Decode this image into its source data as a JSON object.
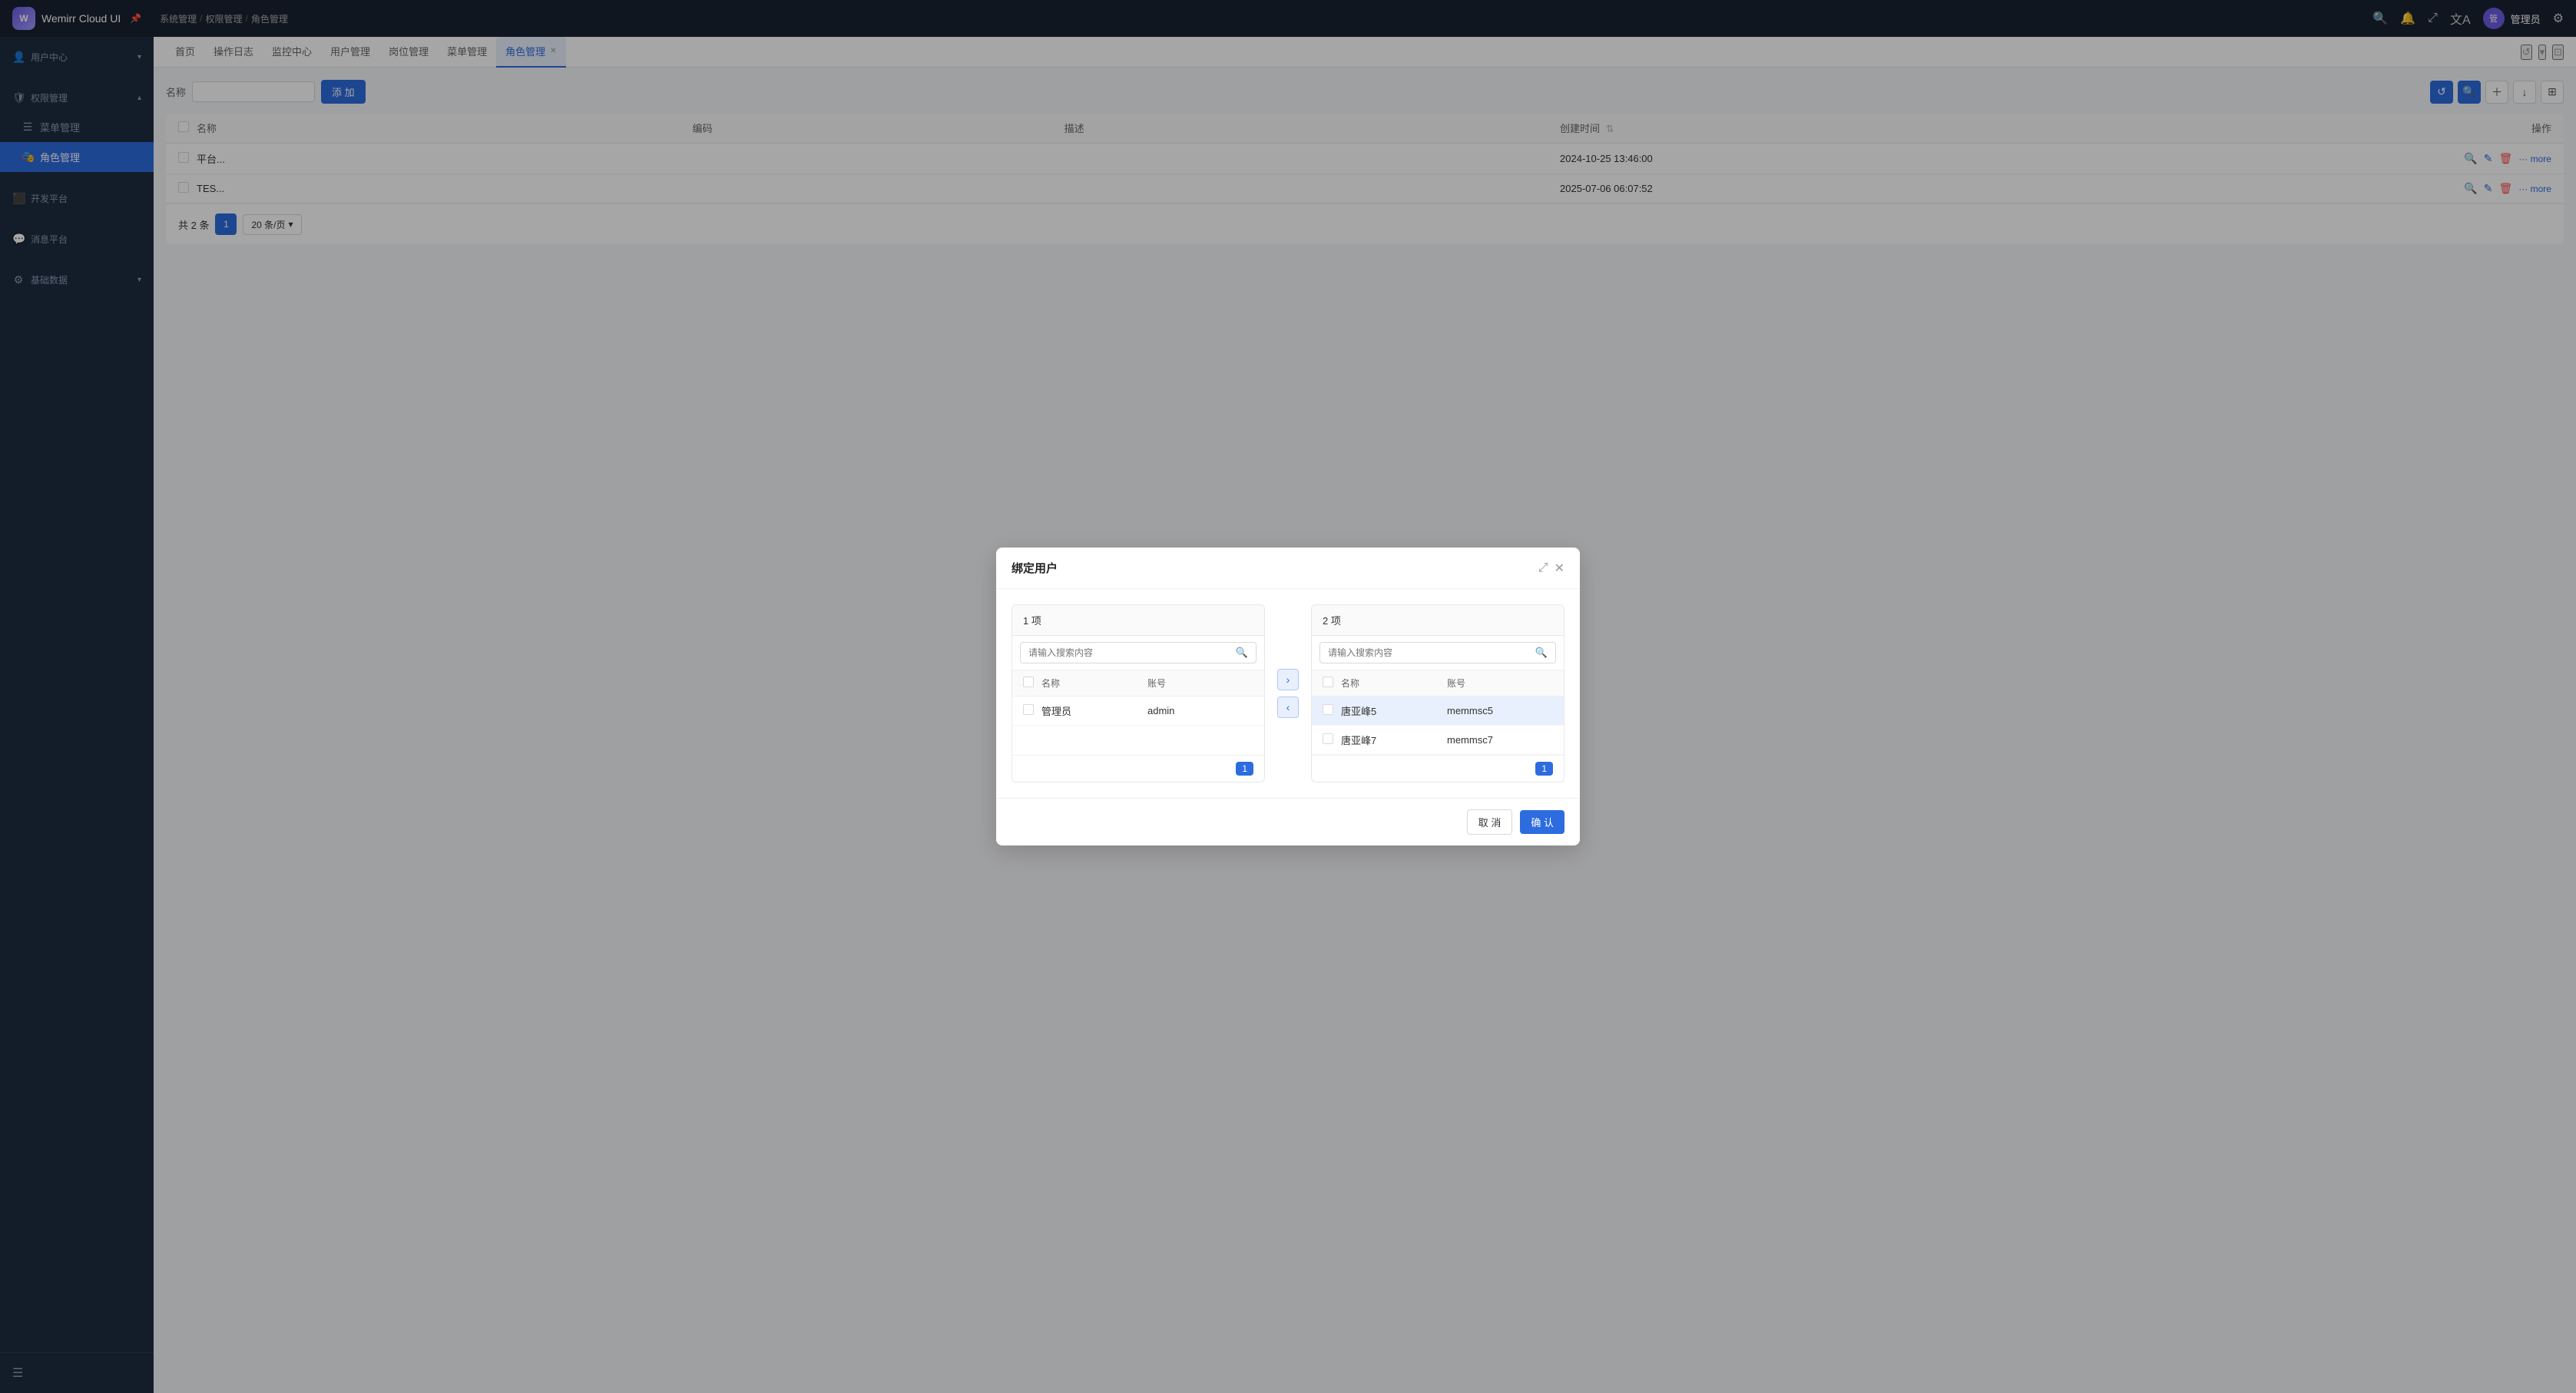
{
  "app": {
    "logo_text": "W",
    "title": "Wemirr Cloud UI",
    "breadcrumb": [
      "系统管理",
      "权限管理",
      "角色管理"
    ]
  },
  "top_actions": {
    "search_icon": "🔍",
    "bell_icon": "🔔",
    "expand_icon": "⤢",
    "translate_icon": "文A",
    "user_name": "管理员",
    "settings_icon": "⚙"
  },
  "sidebar": {
    "sections": [
      {
        "label": "用户中心",
        "icon": "👤",
        "expanded": false
      },
      {
        "label": "权限管理",
        "icon": "🛡",
        "expanded": true,
        "children": [
          {
            "label": "菜单管理",
            "icon": "☰",
            "active": false
          },
          {
            "label": "角色管理",
            "icon": "🎭",
            "active": true
          }
        ]
      },
      {
        "label": "开发平台",
        "icon": "⬛",
        "expanded": false
      },
      {
        "label": "消息平台",
        "icon": "💬",
        "expanded": false
      },
      {
        "label": "基础数据",
        "icon": "⚙",
        "expanded": false
      }
    ],
    "bottom_icon": "☰"
  },
  "tabs": [
    {
      "label": "首页",
      "active": false,
      "closeable": false
    },
    {
      "label": "操作日志",
      "active": false,
      "closeable": false
    },
    {
      "label": "监控中心",
      "active": false,
      "closeable": false
    },
    {
      "label": "用户管理",
      "active": false,
      "closeable": false
    },
    {
      "label": "岗位管理",
      "active": false,
      "closeable": false
    },
    {
      "label": "菜单管理",
      "active": false,
      "closeable": false
    },
    {
      "label": "角色管理",
      "active": true,
      "closeable": true
    }
  ],
  "page": {
    "title": "名称",
    "add_btn": "添 加",
    "table": {
      "columns": [
        "名称",
        "编码",
        "描述",
        "",
        "操作"
      ],
      "rows": [
        {
          "name": "平台...",
          "code": "",
          "desc": "",
          "time": "2024-10-25 13:46:00",
          "actions": [
            "search",
            "edit",
            "delete",
            "more"
          ]
        },
        {
          "name": "TES...",
          "code": "",
          "desc": "",
          "time": "2025-07-06 06:07:52",
          "actions": [
            "search",
            "edit",
            "delete",
            "more"
          ]
        }
      ]
    },
    "pagination": {
      "total": "共 2 条",
      "current_page": 1,
      "page_size": "20 条/页"
    }
  },
  "modal": {
    "title": "绑定用户",
    "left_panel": {
      "count_label": "1 项",
      "search_placeholder": "请输入搜索内容",
      "col_name": "名称",
      "col_account": "账号",
      "rows": [
        {
          "name": "管理员",
          "account": "admin",
          "checked": false
        }
      ],
      "page": "1"
    },
    "right_panel": {
      "count_label": "2 项",
      "search_placeholder": "请输入搜索内容",
      "col_name": "名称",
      "col_account": "账号",
      "rows": [
        {
          "name": "唐亚峰5",
          "account": "memmsc5",
          "checked": false,
          "selected": true
        },
        {
          "name": "唐亚峰7",
          "account": "memmsc7",
          "checked": false,
          "selected": false
        }
      ],
      "page": "1"
    },
    "cancel_btn": "取 消",
    "confirm_btn": "确 认"
  }
}
